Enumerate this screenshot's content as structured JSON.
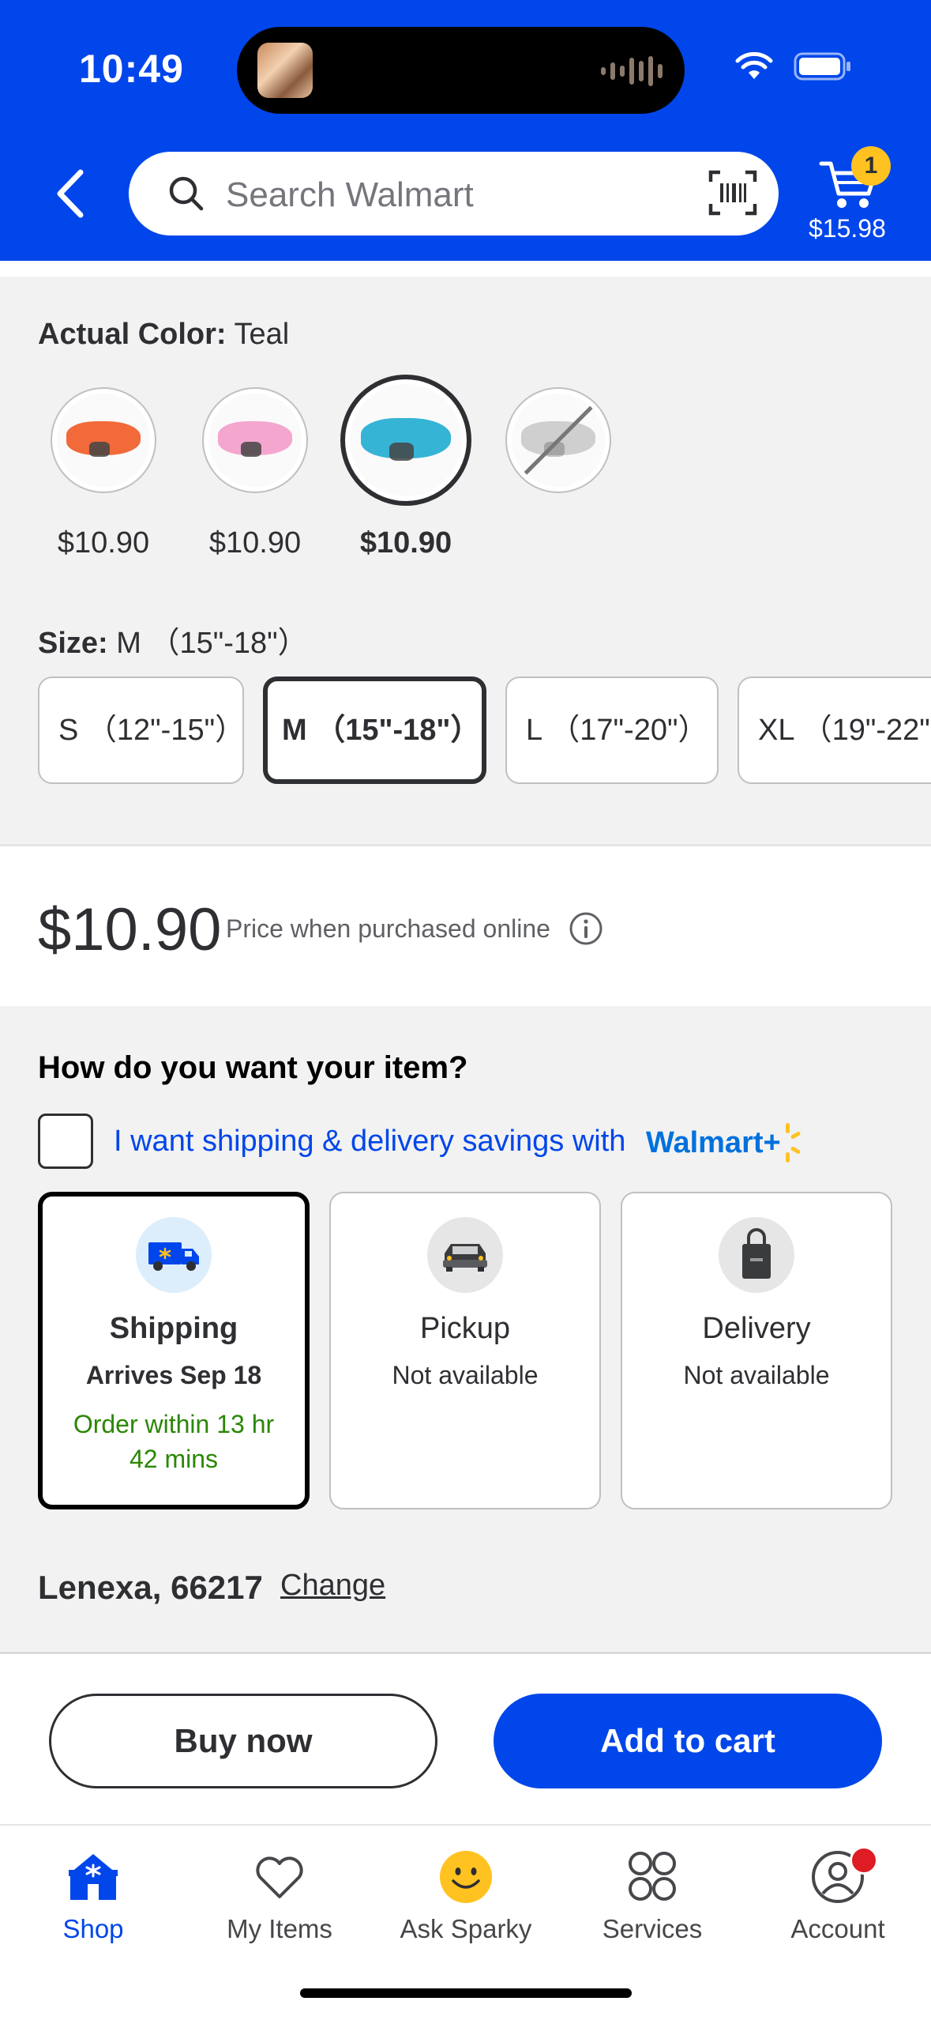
{
  "status_bar": {
    "time": "10:49"
  },
  "header": {
    "search_placeholder": "Search Walmart",
    "cart_count": "1",
    "cart_total": "$15.98",
    "icons": [
      "back-arrow-icon",
      "search-icon",
      "barcode-scanner-icon",
      "cart-icon"
    ]
  },
  "variants": {
    "color_label": "Actual Color:",
    "color_value": "Teal",
    "swatches": [
      {
        "color": "#f26a3a",
        "price": "$10.90",
        "available": true,
        "selected": false
      },
      {
        "color": "#f4a6cf",
        "price": "$10.90",
        "available": true,
        "selected": false
      },
      {
        "color": "#35b4d6",
        "price": "$10.90",
        "available": true,
        "selected": true
      },
      {
        "color": "#cfcfcf",
        "price": "",
        "available": false,
        "selected": false
      }
    ],
    "size_label": "Size:",
    "size_value": "M （15\"-18\"）",
    "sizes": [
      {
        "label": "S （12\"-15\"）",
        "selected": false
      },
      {
        "label": "M （15\"-18\"）",
        "selected": true
      },
      {
        "label": "L （17\"-20\"）",
        "selected": false
      },
      {
        "label": "XL （19\"-22\"）",
        "selected": false
      }
    ]
  },
  "price": {
    "amount": "$10.90",
    "note": "Price when purchased online"
  },
  "fulfillment": {
    "title": "How do you want your item?",
    "plus_text": "I want shipping & delivery savings with",
    "plus_brand": "Walmart+",
    "options": [
      {
        "name": "Shipping",
        "sub": "Arrives Sep 18",
        "note": "Order within 13 hr 42 mins",
        "selected": true,
        "icon": "shipping-truck-icon"
      },
      {
        "name": "Pickup",
        "sub": "Not available",
        "note": "",
        "selected": false,
        "icon": "pickup-car-icon"
      },
      {
        "name": "Delivery",
        "sub": "Not available",
        "note": "",
        "selected": false,
        "icon": "delivery-bag-icon"
      }
    ],
    "location": "Lenexa, 66217",
    "change_label": "Change"
  },
  "actions": {
    "buy_now": "Buy now",
    "add_to_cart": "Add to cart"
  },
  "colors": {
    "brand_blue": "#0046ea",
    "spark_yellow": "#ffc220",
    "success_green": "#2a8703"
  },
  "tabbar": [
    {
      "label": "Shop",
      "icon": "shop-icon",
      "active": true
    },
    {
      "label": "My Items",
      "icon": "heart-icon",
      "active": false
    },
    {
      "label": "Ask Sparky",
      "icon": "sparky-smiley-icon",
      "active": false
    },
    {
      "label": "Services",
      "icon": "services-grid-icon",
      "active": false
    },
    {
      "label": "Account",
      "icon": "account-icon",
      "active": false
    }
  ]
}
